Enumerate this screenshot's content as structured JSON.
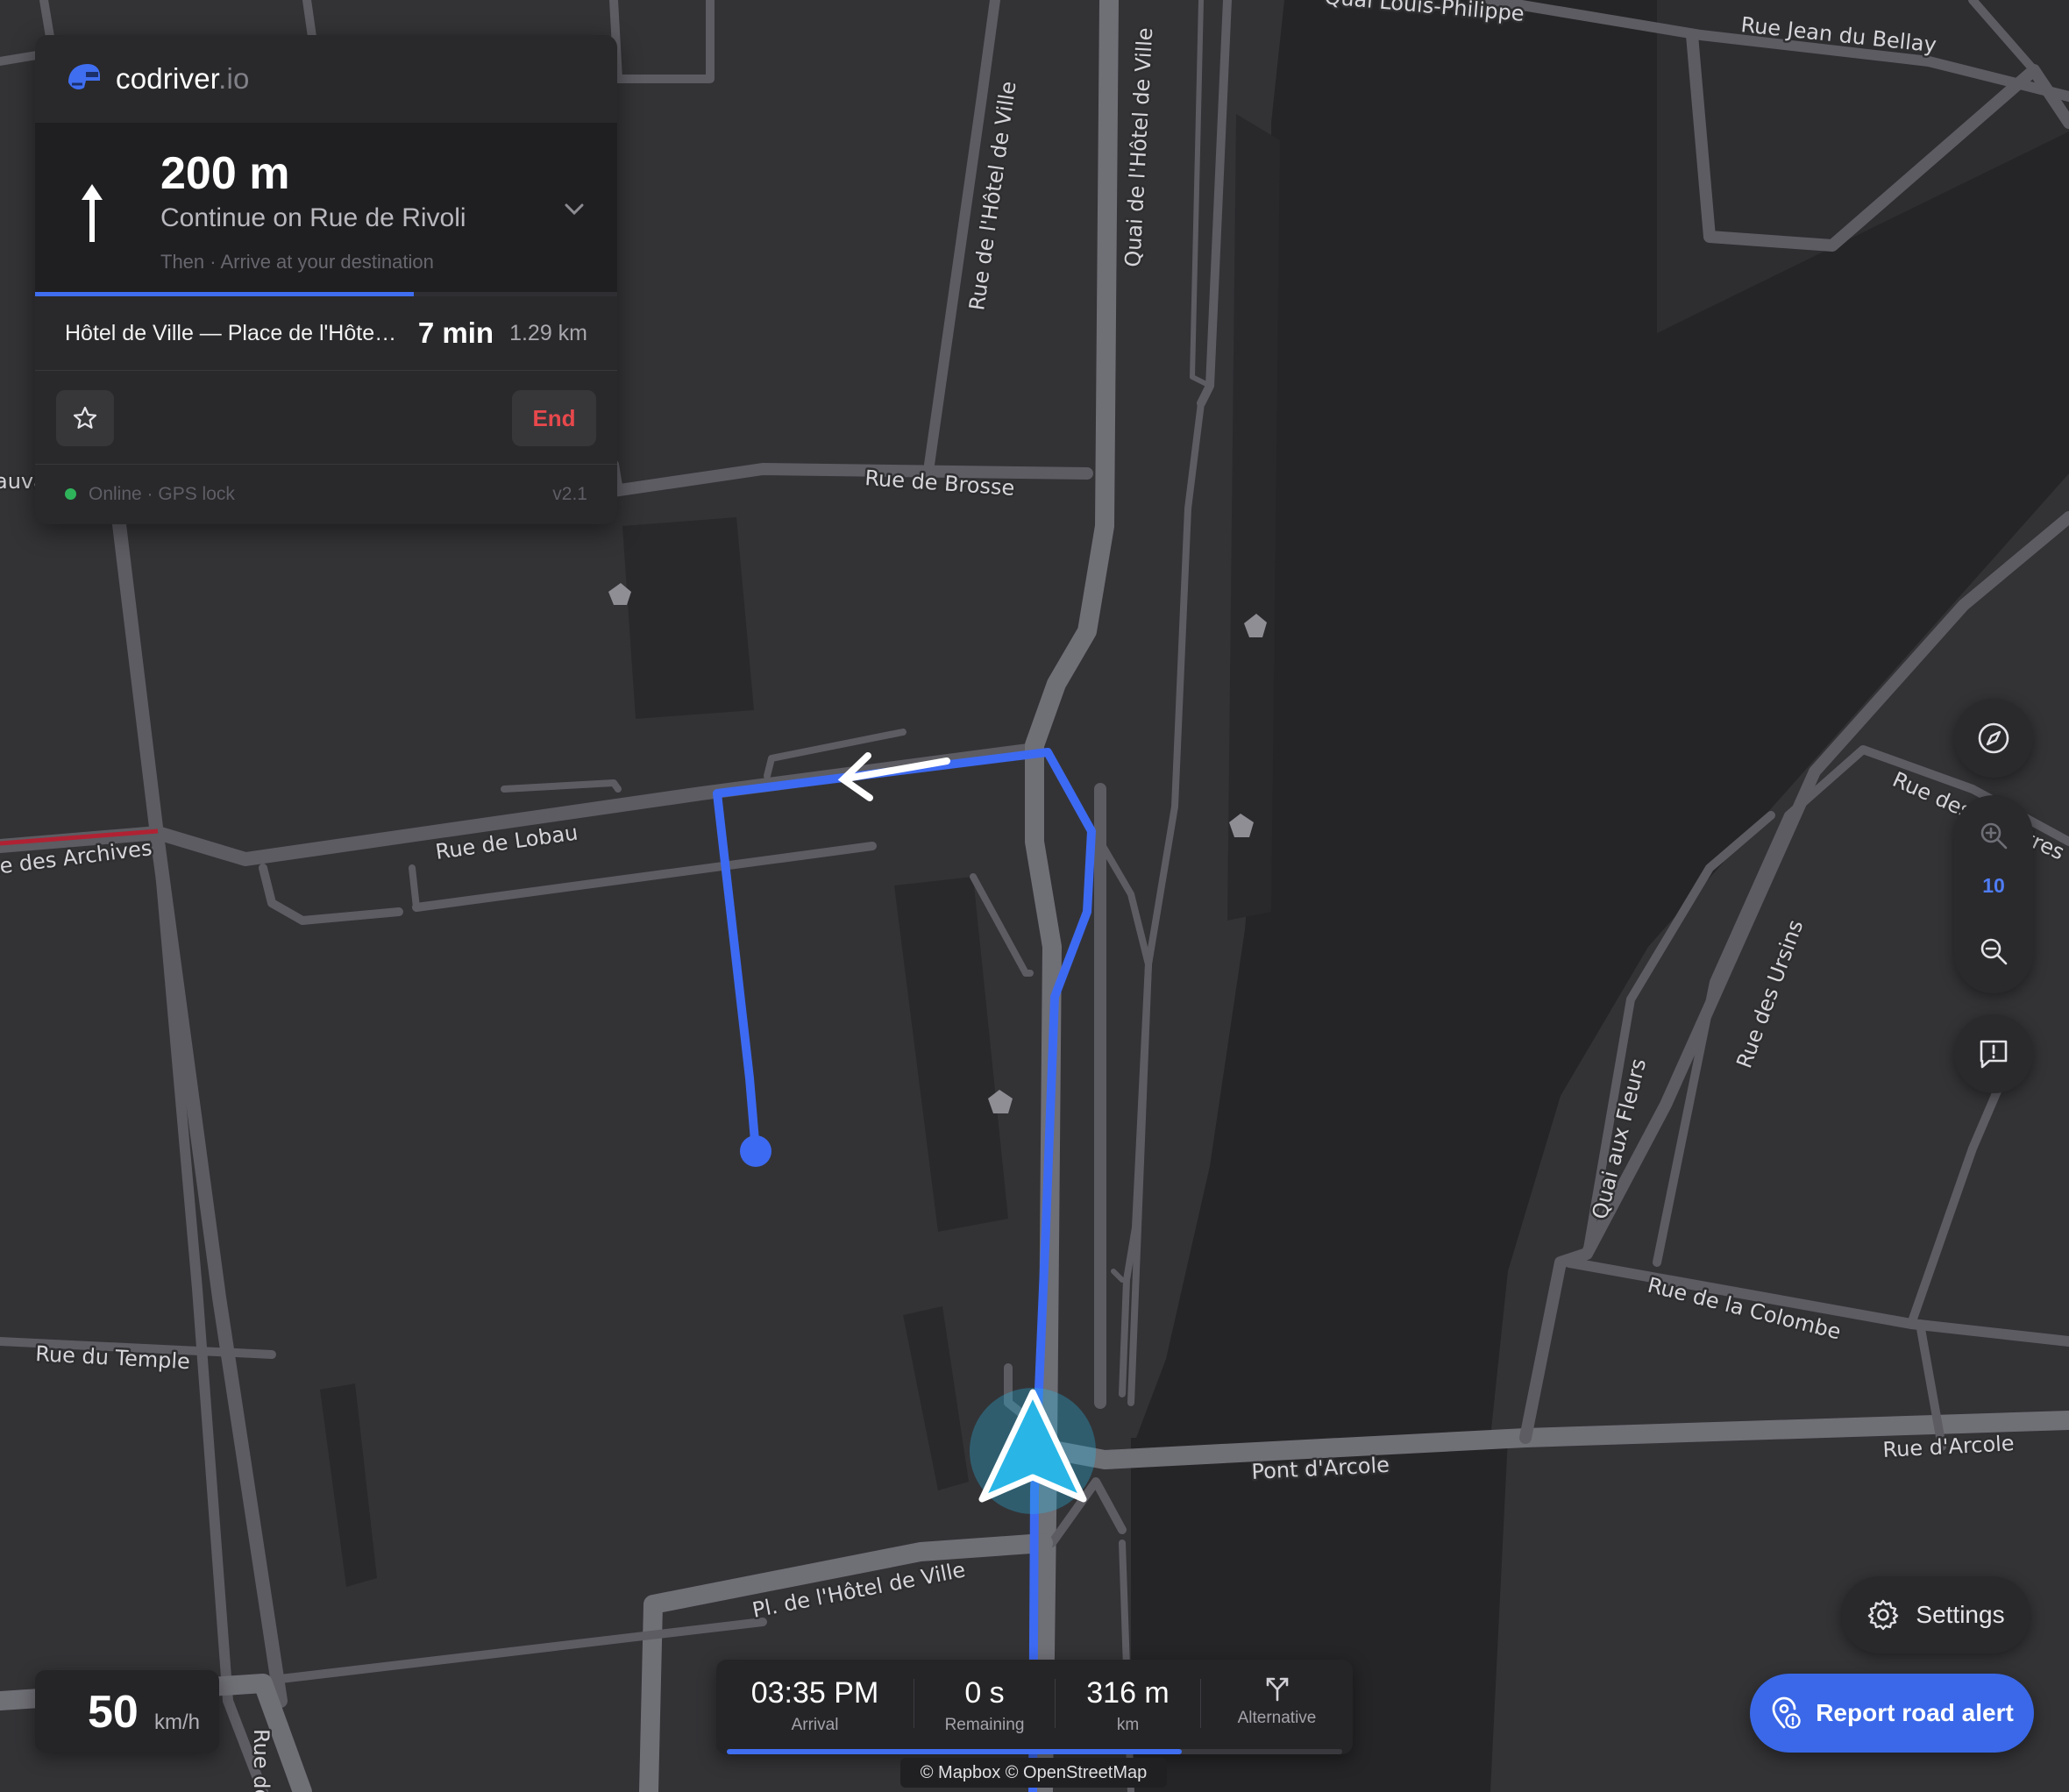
{
  "brand": {
    "name": "codriver",
    "tld": ".io"
  },
  "maneuver": {
    "distance": "200 m",
    "instruction": "Continue on Rue de Rivoli",
    "next": "Then · Arrive at your destination",
    "progress": 0.65
  },
  "route": {
    "destination": "Hôtel de Ville — Place de l'Hôtel de Ville",
    "eta": "7 min",
    "distance": "1.29 km"
  },
  "actions": {
    "end_label": "End"
  },
  "status": {
    "text": "Online · GPS lock",
    "version": "v2.1"
  },
  "speed": {
    "value": "50",
    "unit": "km/h"
  },
  "trip": {
    "arrival_value": "03:35 PM",
    "arrival_label": "Arrival",
    "remaining_value": "0 s",
    "remaining_label": "Remaining",
    "distance_value": "316 m",
    "distance_label": "km",
    "alternative_label": "Alternative",
    "progress": 0.74
  },
  "attribution": "© Mapbox © OpenStreetMap",
  "zoom": {
    "level": "10"
  },
  "settings_label": "Settings",
  "report_label": "Report road alert",
  "map_labels": {
    "rue_jean_du_bellay": "Rue Jean du Bellay",
    "quai_philippe": "Quai Louis-Philippe",
    "rue_hotel_de_ville": "Rue de l'Hôtel de Ville",
    "quai_hotel_de_ville": "Quai de l'Hôtel de Ville",
    "rue_de_brosse": "Rue de Brosse",
    "rue_de_lobau": "Rue de Lobau",
    "rue_des_archives": "Rue des Archives",
    "rue_du_temple": "Rue du Temple",
    "pont_darcole": "Pont d'Arcole",
    "rue_darcole": "Rue d'Arcole",
    "pl_hotel_de_ville": "Pl. de l'Hôtel de Ville",
    "quai_aux_fleurs": "Quai aux Fleurs",
    "rue_des_ursins": "Rue des Ursins",
    "rue_des_chantres": "Rue des Chantres",
    "rue_de_la_colombe": "Rue de la Colombe",
    "left_edge_fragment": "auva",
    "bottom_fragment": "Rue de"
  },
  "colors": {
    "route": "#3d6af2",
    "position_marker": "#29b6e6",
    "accent": "#3a68e8",
    "end": "#e8484c",
    "online": "#2fb35a"
  }
}
